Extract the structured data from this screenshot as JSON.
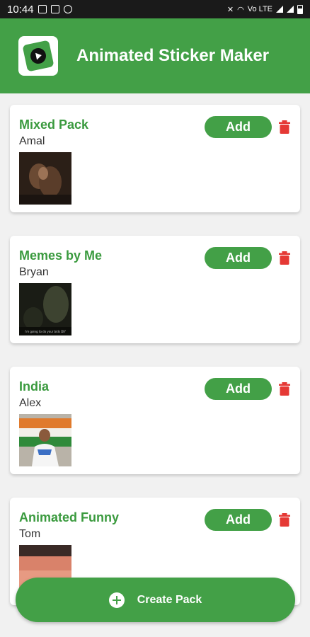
{
  "status_bar": {
    "time": "10:44",
    "network": "Vo LTE"
  },
  "app_bar": {
    "title": "Animated Sticker Maker",
    "icon": "play-logo-icon"
  },
  "colors": {
    "accent": "#43a047",
    "title_green": "#3a9a3e",
    "delete_red": "#e53935",
    "status_bar": "#1a1a1a"
  },
  "packs": [
    {
      "name": "Mixed Pack",
      "author": "Amal",
      "add_label": "Add"
    },
    {
      "name": "Memes by Me",
      "author": "Bryan",
      "add_label": "Add",
      "thumb_caption": "i'm going to do your bids DIY"
    },
    {
      "name": "India",
      "author": "Alex",
      "add_label": "Add"
    },
    {
      "name": "Animated Funny",
      "author": "Tom",
      "add_label": "Add"
    }
  ],
  "fab": {
    "label": "Create Pack",
    "icon": "plus-circle-icon"
  }
}
